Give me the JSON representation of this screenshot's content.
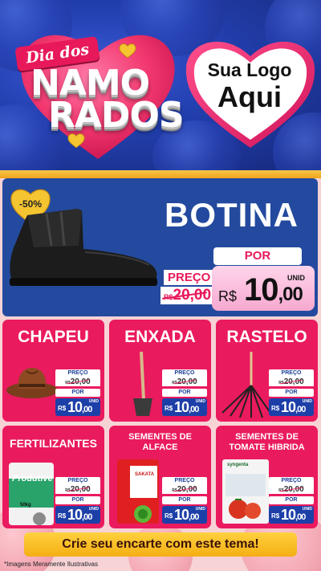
{
  "header": {
    "ribbon": "Dia dos",
    "title_line1": "NAMO",
    "title_line2": "RADOS",
    "logo_line1": "Sua Logo",
    "logo_line2": "Aqui"
  },
  "featured": {
    "discount": "-50%",
    "name": "BOTINA",
    "preco_label": "PREÇO",
    "old_currency": "R$",
    "old_price": "20,00",
    "por_label": "POR",
    "unid_label": "UNID",
    "currency": "R$",
    "price_int": "10",
    "price_cents": ",00"
  },
  "products": [
    {
      "name": "CHAPEU",
      "preco_label": "PREÇO",
      "old_currency": "R$",
      "old_price": "20,00",
      "por_label": "POR",
      "currency": "R$",
      "price_int": "10",
      "price_cents": ",00",
      "unid_label": "UNID"
    },
    {
      "name": "ENXADA",
      "preco_label": "PREÇO",
      "old_currency": "R$",
      "old_price": "20,00",
      "por_label": "POR",
      "currency": "R$",
      "price_int": "10",
      "price_cents": ",00",
      "unid_label": "UNID"
    },
    {
      "name": "RASTELO",
      "preco_label": "PREÇO",
      "old_currency": "R$",
      "old_price": "20,00",
      "por_label": "POR",
      "currency": "R$",
      "price_int": "10",
      "price_cents": ",00",
      "unid_label": "UNID"
    },
    {
      "name": "FERTILIZANTES",
      "preco_label": "PREÇO",
      "old_currency": "R$",
      "old_price": "20,00",
      "por_label": "POR",
      "currency": "R$",
      "price_int": "10",
      "price_cents": ",00",
      "unid_label": "UNID",
      "pack_brand": "Produtive",
      "pack_weight": "50kg"
    },
    {
      "name_line1": "SEMENTES DE",
      "name_line2": "ALFACE",
      "preco_label": "PREÇO",
      "old_currency": "R$",
      "old_price": "20,00",
      "por_label": "POR",
      "currency": "R$",
      "price_int": "10",
      "price_cents": ",00",
      "unid_label": "UNID",
      "pack_brand": "SAKATA"
    },
    {
      "name_line1": "SEMENTES DE",
      "name_line2": "TOMATE HIBRIDA",
      "preco_label": "PREÇO",
      "old_currency": "R$",
      "old_price": "20,00",
      "por_label": "POR",
      "currency": "R$",
      "price_int": "10",
      "price_cents": ",00",
      "unid_label": "UNID",
      "pack_brand": "syngenta"
    }
  ],
  "cta": "Crie seu encarte com este tema!",
  "disclaimer": "*Imagens Meramente Ilustrativas",
  "colors": {
    "header_blue": "#2340b0",
    "panel_pink": "#f7d3d6",
    "card_pink": "#ea1a5e",
    "hero_blue": "#234a9e",
    "price_blue": "#1d3fa8",
    "cta_yellow": "#ffd23f"
  }
}
